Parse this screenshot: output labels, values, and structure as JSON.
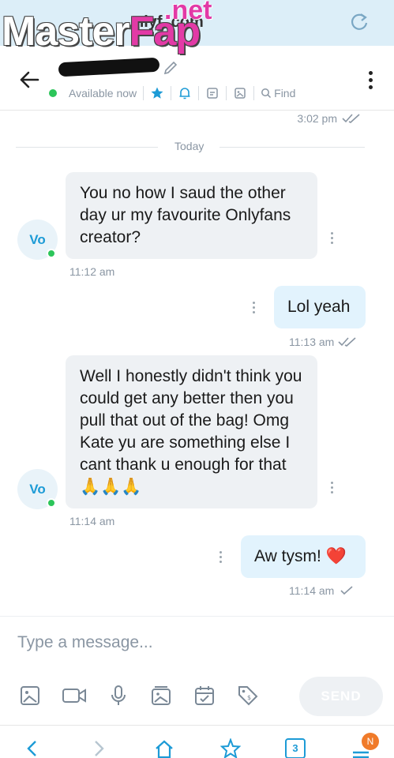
{
  "browser": {
    "url_fragment": "nlyf    .com",
    "watermark_main": "Master",
    "watermark_accent": "Fap",
    "watermark_net": ".net"
  },
  "header": {
    "contact_name": "redacted",
    "status": "Available now",
    "find_label": "Find"
  },
  "conversation": {
    "top_time": "3:02 pm",
    "day_separator": "Today",
    "avatar_initials": "Vo",
    "messages": [
      {
        "direction": "in",
        "text": "You no how I saud the other day ur my favourite Onlyfans creator?",
        "time": "11:12 am"
      },
      {
        "direction": "out",
        "text": "Lol yeah",
        "time": "11:13 am"
      },
      {
        "direction": "in",
        "text": "Well I honestly didn't think you could get any better then you pull that out of the bag! Omg Kate yu are something else I cant thank u enough for that 🙏🙏🙏",
        "time": "11:14 am"
      },
      {
        "direction": "out",
        "text": "Aw tysm! ❤️",
        "time": "11:14 am"
      }
    ]
  },
  "composer": {
    "placeholder": "Type a message...",
    "send_label": "SEND"
  },
  "bottom_nav": {
    "tabs_count": "3",
    "badge": "N"
  },
  "colors": {
    "accent": "#1d9bd6",
    "online": "#2cc55a",
    "incoming_bubble": "#eef1f4",
    "outgoing_bubble": "#e2f3fd",
    "badge": "#f07b2a"
  }
}
